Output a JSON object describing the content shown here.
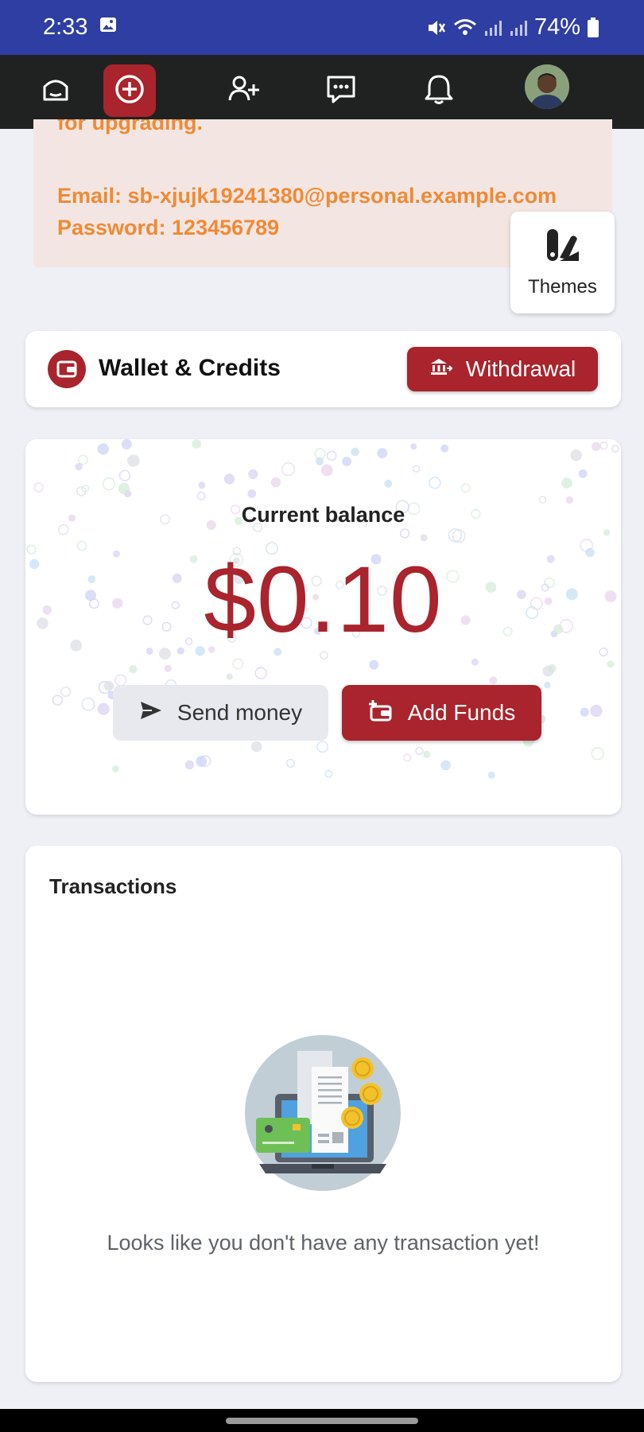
{
  "status_bar": {
    "time": "2:33",
    "battery": "74%",
    "icons": [
      "image-icon",
      "mute-icon",
      "wifi-icon",
      "signal-icon",
      "signal-icon",
      "battery-icon"
    ]
  },
  "nav": {
    "items": [
      "home-icon",
      "create-post-icon",
      "add-friend-icon",
      "messages-icon",
      "notifications-icon",
      "avatar"
    ],
    "active": "create-post-icon"
  },
  "info_note": {
    "partial_text": "for upgrading.",
    "email": "Email: sb-xjujk19241380@personal.example.com",
    "password": "Password: 123456789"
  },
  "themes": {
    "label": "Themes"
  },
  "wallet": {
    "title": "Wallet & Credits",
    "withdraw_label": "Withdrawal"
  },
  "balance": {
    "label": "Current balance",
    "amount": "$0.10",
    "send_label": "Send money",
    "add_label": "Add Funds"
  },
  "transactions": {
    "title": "Transactions",
    "empty_text": "Looks like you don't have any transaction yet!"
  },
  "colors": {
    "brand": "#a9242c",
    "status_bar": "#2f3ea3",
    "nav_bg": "#1f2221",
    "note_text": "#f08a35",
    "note_bg": "#f3e6e2",
    "page_bg": "#eff0f6"
  }
}
